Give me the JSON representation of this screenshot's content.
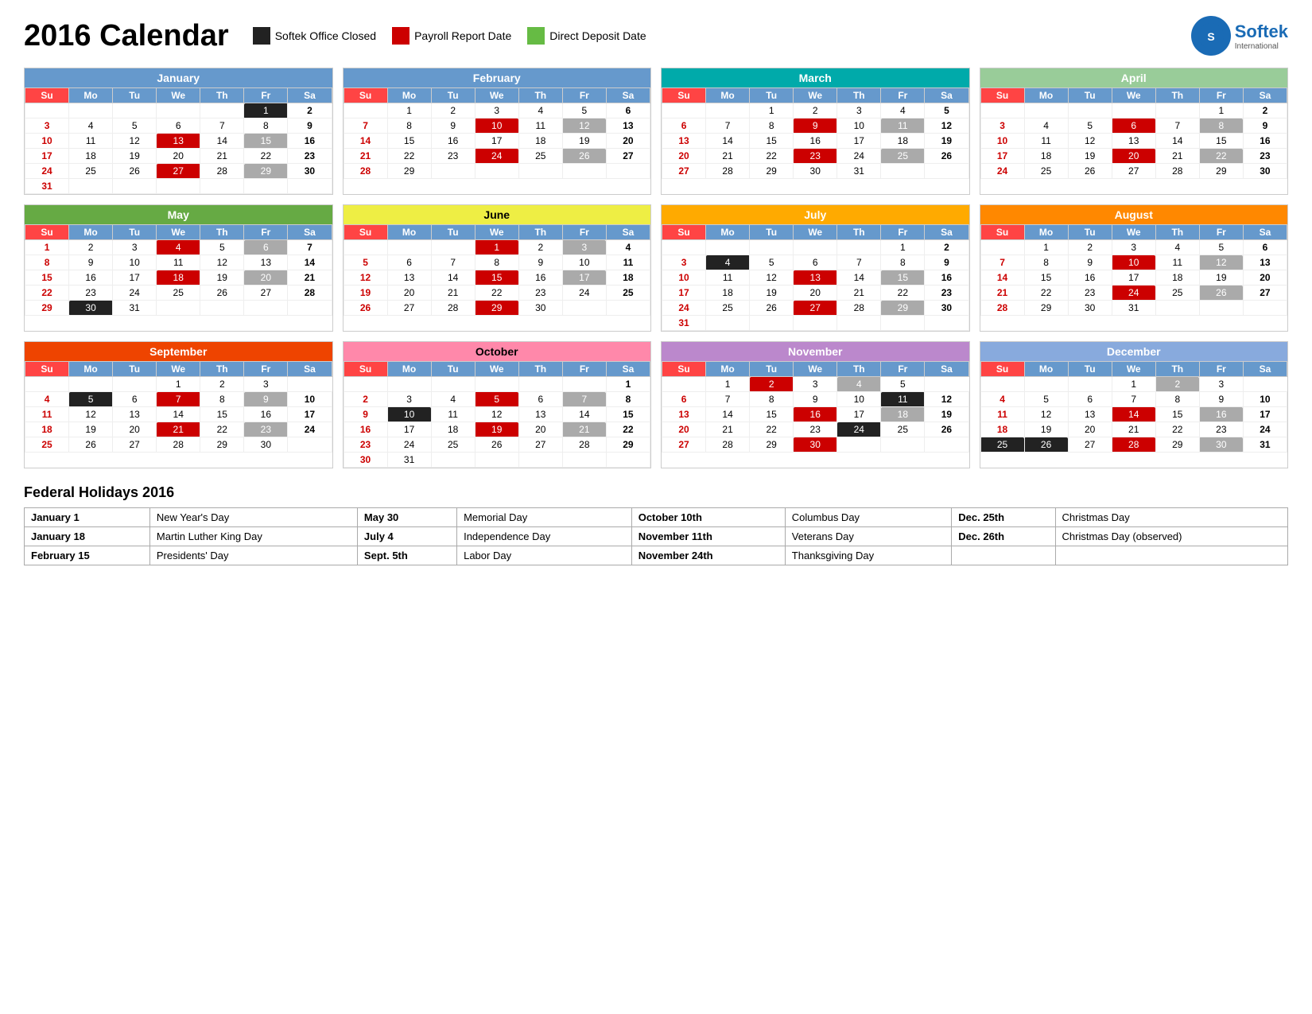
{
  "header": {
    "title": "2016 Calendar",
    "legend": [
      {
        "color": "#222222",
        "label": "Softek Office Closed"
      },
      {
        "color": "#cc0000",
        "label": "Payroll Report Date"
      },
      {
        "color": "#66bb44",
        "label": "Direct Deposit Date"
      }
    ],
    "logo_text": "Softek",
    "logo_sub": "International"
  },
  "months": [
    {
      "name": "January",
      "class": "jan",
      "weeks": [
        [
          "",
          "",
          "",
          "",
          "",
          "1",
          "2"
        ],
        [
          "3",
          "4",
          "5",
          "6",
          "7",
          "8",
          "9"
        ],
        [
          "10",
          "11",
          "12",
          "13",
          "14",
          "15",
          "16"
        ],
        [
          "17",
          "18",
          "19",
          "20",
          "21",
          "22",
          "23"
        ],
        [
          "24",
          "25",
          "26",
          "27",
          "28",
          "29",
          "30"
        ],
        [
          "31",
          "",
          "",
          "",
          "",
          "",
          ""
        ]
      ],
      "specials": {
        "1": "closed",
        "13": "payroll",
        "15": "gray",
        "18": "sun-red",
        "27": "payroll",
        "29": "gray"
      }
    },
    {
      "name": "February",
      "class": "feb",
      "weeks": [
        [
          "",
          "1",
          "2",
          "3",
          "4",
          "5",
          "6"
        ],
        [
          "7",
          "8",
          "9",
          "10",
          "11",
          "12",
          "13"
        ],
        [
          "14",
          "15",
          "16",
          "17",
          "18",
          "19",
          "20"
        ],
        [
          "21",
          "22",
          "23",
          "24",
          "25",
          "26",
          "27"
        ],
        [
          "28",
          "29",
          "",
          "",
          "",
          "",
          ""
        ]
      ],
      "specials": {
        "10": "payroll",
        "12": "gray",
        "15": "sun-red",
        "24": "payroll",
        "26": "gray"
      }
    },
    {
      "name": "March",
      "class": "mar",
      "weeks": [
        [
          "",
          "",
          "1",
          "2",
          "3",
          "4",
          "5"
        ],
        [
          "6",
          "7",
          "8",
          "9",
          "10",
          "11",
          "12"
        ],
        [
          "13",
          "14",
          "15",
          "16",
          "17",
          "18",
          "19"
        ],
        [
          "20",
          "21",
          "22",
          "23",
          "24",
          "25",
          "26"
        ],
        [
          "27",
          "28",
          "29",
          "30",
          "31",
          "",
          ""
        ]
      ],
      "specials": {
        "9": "payroll",
        "11": "gray",
        "23": "payroll",
        "25": "gray"
      }
    },
    {
      "name": "April",
      "class": "apr",
      "weeks": [
        [
          "",
          "",
          "",
          "",
          "",
          "1",
          "2"
        ],
        [
          "3",
          "4",
          "5",
          "6",
          "7",
          "8",
          "9"
        ],
        [
          "10",
          "11",
          "12",
          "13",
          "14",
          "15",
          "16"
        ],
        [
          "17",
          "18",
          "19",
          "20",
          "21",
          "22",
          "23"
        ],
        [
          "24",
          "25",
          "26",
          "27",
          "28",
          "29",
          "30"
        ]
      ],
      "specials": {
        "6": "payroll",
        "8": "gray",
        "20": "payroll",
        "22": "gray"
      }
    },
    {
      "name": "May",
      "class": "may",
      "weeks": [
        [
          "1",
          "2",
          "3",
          "4",
          "5",
          "6",
          "7"
        ],
        [
          "8",
          "9",
          "10",
          "11",
          "12",
          "13",
          "14"
        ],
        [
          "15",
          "16",
          "17",
          "18",
          "19",
          "20",
          "21"
        ],
        [
          "22",
          "23",
          "24",
          "25",
          "26",
          "27",
          "28"
        ],
        [
          "29",
          "30",
          "31",
          "",
          "",
          "",
          ""
        ]
      ],
      "specials": {
        "4": "payroll",
        "6": "gray",
        "18": "payroll",
        "20": "gray",
        "30": "closed"
      }
    },
    {
      "name": "June",
      "class": "jun",
      "weeks": [
        [
          "",
          "",
          "",
          "1",
          "2",
          "3",
          "4"
        ],
        [
          "5",
          "6",
          "7",
          "8",
          "9",
          "10",
          "11"
        ],
        [
          "12",
          "13",
          "14",
          "15",
          "16",
          "17",
          "18"
        ],
        [
          "19",
          "20",
          "21",
          "22",
          "23",
          "24",
          "25"
        ],
        [
          "26",
          "27",
          "28",
          "29",
          "30",
          "",
          ""
        ]
      ],
      "specials": {
        "1": "payroll",
        "3": "gray",
        "15": "payroll",
        "17": "gray",
        "29": "payroll"
      }
    },
    {
      "name": "July",
      "class": "jul",
      "weeks": [
        [
          "",
          "",
          "",
          "",
          "",
          "1",
          "2"
        ],
        [
          "3",
          "4",
          "5",
          "6",
          "7",
          "8",
          "9"
        ],
        [
          "10",
          "11",
          "12",
          "13",
          "14",
          "15",
          "16"
        ],
        [
          "17",
          "18",
          "19",
          "20",
          "21",
          "22",
          "23"
        ],
        [
          "24",
          "25",
          "26",
          "27",
          "28",
          "29",
          "30"
        ],
        [
          "31",
          "",
          "",
          "",
          "",
          "",
          ""
        ]
      ],
      "specials": {
        "4": "closed",
        "13": "payroll",
        "15": "gray",
        "27": "payroll",
        "29": "gray"
      }
    },
    {
      "name": "August",
      "class": "aug",
      "weeks": [
        [
          "",
          "1",
          "2",
          "3",
          "4",
          "5",
          "6"
        ],
        [
          "7",
          "8",
          "9",
          "10",
          "11",
          "12",
          "13"
        ],
        [
          "14",
          "15",
          "16",
          "17",
          "18",
          "19",
          "20"
        ],
        [
          "21",
          "22",
          "23",
          "24",
          "25",
          "26",
          "27"
        ],
        [
          "28",
          "29",
          "30",
          "31",
          "",
          "",
          ""
        ]
      ],
      "specials": {
        "10": "payroll",
        "12": "gray",
        "24": "payroll",
        "26": "gray"
      }
    },
    {
      "name": "September",
      "class": "sep",
      "weeks": [
        [
          "",
          "",
          "",
          "1",
          "2",
          "3"
        ],
        [
          "4",
          "5",
          "6",
          "7",
          "8",
          "9",
          "10"
        ],
        [
          "11",
          "12",
          "13",
          "14",
          "15",
          "16",
          "17"
        ],
        [
          "18",
          "19",
          "20",
          "21",
          "22",
          "23",
          "24"
        ],
        [
          "25",
          "26",
          "27",
          "28",
          "29",
          "30",
          ""
        ]
      ],
      "specials": {
        "5": "closed",
        "7": "payroll",
        "9": "gray",
        "21": "payroll",
        "23": "gray"
      }
    },
    {
      "name": "October",
      "class": "oct",
      "weeks": [
        [
          "",
          "",
          "",
          "",
          "",
          "",
          "1"
        ],
        [
          "2",
          "3",
          "4",
          "5",
          "6",
          "7",
          "8"
        ],
        [
          "9",
          "10",
          "11",
          "12",
          "13",
          "14",
          "15"
        ],
        [
          "16",
          "17",
          "18",
          "19",
          "20",
          "21",
          "22"
        ],
        [
          "23",
          "24",
          "25",
          "26",
          "27",
          "28",
          "29"
        ],
        [
          "30",
          "31",
          "",
          "",
          "",
          "",
          ""
        ]
      ],
      "specials": {
        "5": "payroll",
        "7": "gray",
        "10": "closed",
        "19": "payroll",
        "21": "gray"
      }
    },
    {
      "name": "November",
      "class": "nov",
      "weeks": [
        [
          "",
          "1",
          "2",
          "3",
          "4",
          "5"
        ],
        [
          "6",
          "7",
          "8",
          "9",
          "10",
          "11",
          "12"
        ],
        [
          "13",
          "14",
          "15",
          "16",
          "17",
          "18",
          "19"
        ],
        [
          "20",
          "21",
          "22",
          "23",
          "24",
          "25",
          "26"
        ],
        [
          "27",
          "28",
          "29",
          "30",
          "",
          "",
          ""
        ]
      ],
      "specials": {
        "2": "payroll",
        "4": "gray",
        "11": "closed",
        "16": "payroll",
        "18": "gray",
        "24": "closed",
        "30": "payroll"
      }
    },
    {
      "name": "December",
      "class": "dec",
      "weeks": [
        [
          "",
          "",
          "",
          "1",
          "2",
          "3"
        ],
        [
          "4",
          "5",
          "6",
          "7",
          "8",
          "9",
          "10"
        ],
        [
          "11",
          "12",
          "13",
          "14",
          "15",
          "16",
          "17"
        ],
        [
          "18",
          "19",
          "20",
          "21",
          "22",
          "23",
          "24"
        ],
        [
          "25",
          "26",
          "27",
          "28",
          "29",
          "30",
          "31"
        ]
      ],
      "specials": {
        "2": "gray",
        "14": "payroll",
        "16": "gray",
        "25": "closed",
        "26": "closed",
        "28": "payroll",
        "30": "gray"
      }
    }
  ],
  "holidays": {
    "title": "Federal Holidays 2016",
    "items": [
      {
        "date": "January 1",
        "name": "New Year's Day"
      },
      {
        "date": "January 18",
        "name": "Martin Luther King Day"
      },
      {
        "date": "February 15",
        "name": "Presidents' Day"
      },
      {
        "date": "May 30",
        "name": "Memorial Day"
      },
      {
        "date": "July 4",
        "name": "Independence Day"
      },
      {
        "date": "Sept. 5th",
        "name": "Labor Day"
      },
      {
        "date": "October 10th",
        "name": "Columbus Day"
      },
      {
        "date": "November 11th",
        "name": "Veterans Day"
      },
      {
        "date": "November 24th",
        "name": "Thanksgiving Day"
      },
      {
        "date": "Dec. 25th",
        "name": "Christmas Day"
      },
      {
        "date": "Dec. 26th",
        "name": "Christmas Day (observed)"
      }
    ]
  }
}
